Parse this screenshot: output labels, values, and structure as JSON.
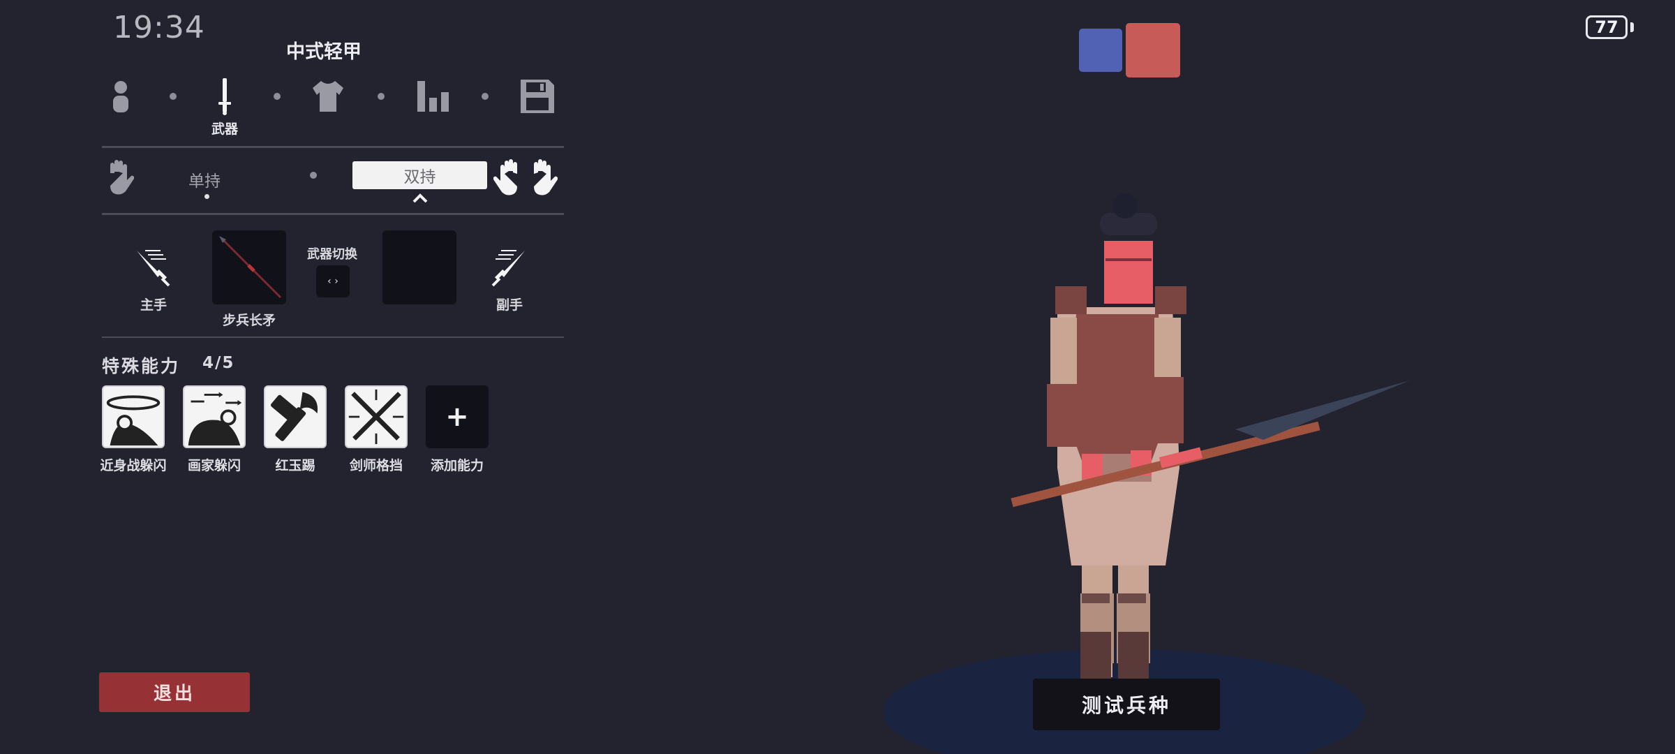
{
  "status_bar": {
    "time": "19:34",
    "battery": "77"
  },
  "unit": {
    "name": "中式轻甲"
  },
  "editor_tabs": [
    {
      "icon": "person-icon",
      "label": ""
    },
    {
      "icon": "sword-icon",
      "label": "武器",
      "active": true
    },
    {
      "icon": "shirt-icon",
      "label": ""
    },
    {
      "icon": "stats-icon",
      "label": ""
    },
    {
      "icon": "save-icon",
      "label": ""
    }
  ],
  "grip": {
    "single_label": "单持",
    "dual_label": "双持",
    "selected": "双持"
  },
  "weapons": {
    "main_hand_label": "主手",
    "main_weapon_name": "步兵长矛",
    "switch_label": "武器切换",
    "off_hand_label": "副手"
  },
  "abilities": {
    "title": "特殊能力",
    "count": "4/5",
    "items": [
      {
        "label": "近身战躲闪",
        "icon": "melee-dodge-icon"
      },
      {
        "label": "画家躲闪",
        "icon": "painter-dodge-icon"
      },
      {
        "label": "红玉踢",
        "icon": "ruby-kick-icon"
      },
      {
        "label": "剑师格挡",
        "icon": "swordmaster-parry-icon"
      },
      {
        "label": "添加能力",
        "icon": "plus-icon"
      }
    ]
  },
  "exit_label": "退出",
  "test_unit_label": "测试兵种",
  "teams": {
    "blue": "#5162b5",
    "red": "#c65b58"
  },
  "colors": {
    "background": "#23222f",
    "exit_button": "#963236",
    "slot": "#111119"
  }
}
